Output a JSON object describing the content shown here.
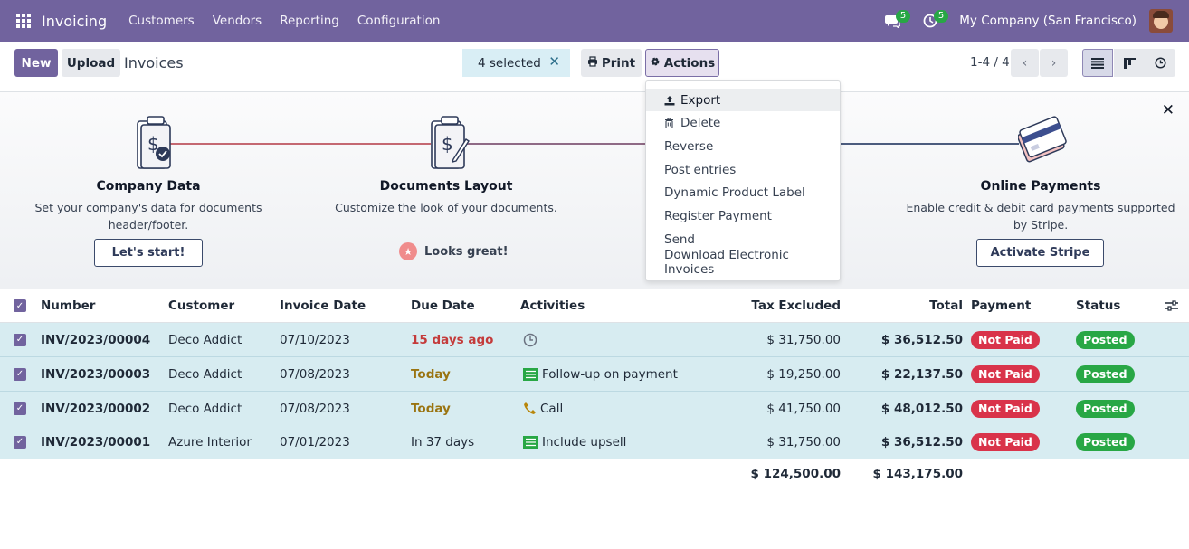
{
  "navbar": {
    "app_name": "Invoicing",
    "menus": [
      "Customers",
      "Vendors",
      "Reporting",
      "Configuration"
    ],
    "messages_count": "5",
    "activities_count": "5",
    "company": "My Company (San Francisco)"
  },
  "control_panel": {
    "new_label": "New",
    "upload_label": "Upload",
    "breadcrumb": "Invoices",
    "selection": "4 selected",
    "print_label": "Print",
    "actions_label": "Actions",
    "pager": "1-4 / 4"
  },
  "actions_menu": {
    "items": [
      "Export",
      "Delete",
      "Reverse",
      "Post entries",
      "Dynamic Product Label",
      "Register Payment",
      "Send",
      "Download Electronic Invoices"
    ]
  },
  "onboarding": {
    "steps": [
      {
        "title": "Company Data",
        "desc": "Set your company's data for documents header/footer.",
        "button": "Let's start!"
      },
      {
        "title": "Documents Layout",
        "desc": "Customize the look of your documents.",
        "done": "Looks great!"
      },
      {
        "title": "Online Payments",
        "desc": "Enable credit & debit card payments supported by Stripe.",
        "button": "Activate Stripe"
      }
    ]
  },
  "table": {
    "headers": [
      "Number",
      "Customer",
      "Invoice Date",
      "Due Date",
      "Activities",
      "Tax Excluded",
      "Total",
      "Payment",
      "Status"
    ],
    "rows": [
      {
        "number": "INV/2023/00004",
        "customer": "Deco Addict",
        "invoice_date": "07/10/2023",
        "due": "15 days ago",
        "activity": "",
        "tax_excluded": "$ 31,750.00",
        "total": "$ 36,512.50",
        "payment": "Not Paid",
        "status": "Posted"
      },
      {
        "number": "INV/2023/00003",
        "customer": "Deco Addict",
        "invoice_date": "07/08/2023",
        "due": "Today",
        "activity": "Follow-up on payment",
        "tax_excluded": "$ 19,250.00",
        "total": "$ 22,137.50",
        "payment": "Not Paid",
        "status": "Posted"
      },
      {
        "number": "INV/2023/00002",
        "customer": "Deco Addict",
        "invoice_date": "07/08/2023",
        "due": "Today",
        "activity": "Call",
        "tax_excluded": "$ 41,750.00",
        "total": "$ 48,012.50",
        "payment": "Not Paid",
        "status": "Posted"
      },
      {
        "number": "INV/2023/00001",
        "customer": "Azure Interior",
        "invoice_date": "07/01/2023",
        "due": "In 37 days",
        "activity": "Include upsell",
        "tax_excluded": "$ 31,750.00",
        "total": "$ 36,512.50",
        "payment": "Not Paid",
        "status": "Posted"
      }
    ],
    "totals": {
      "tax_excluded": "$ 124,500.00",
      "total": "$ 143,175.00"
    }
  },
  "colors": {
    "brand": "#71639e",
    "selection_row": "#d7ecf1",
    "not_paid": "#d9334a",
    "posted": "#28a745"
  }
}
